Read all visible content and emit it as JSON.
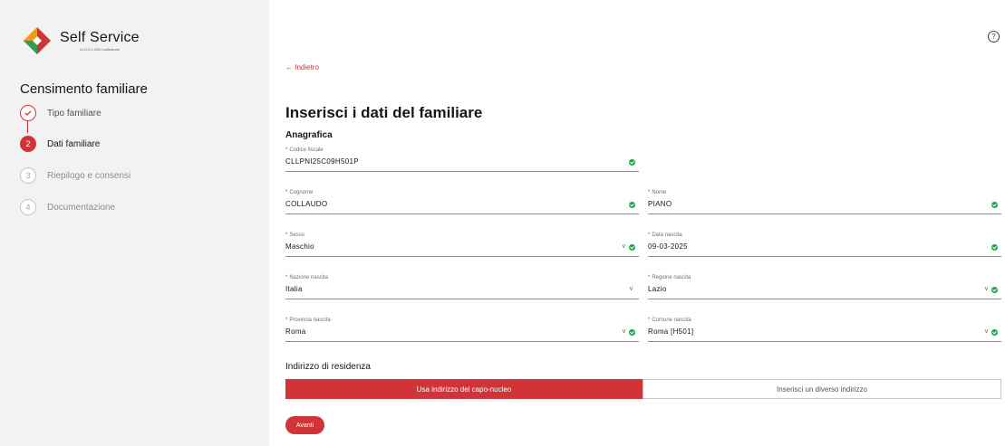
{
  "brand": {
    "title": "Self Service",
    "version": "v1.0.2-1.233.0-milestone",
    "colors": {
      "accent": "#d13438",
      "success": "#24a148"
    }
  },
  "sidebar": {
    "title": "Censimento familiare",
    "steps": [
      {
        "number": "",
        "icon": "check-icon",
        "label": "Tipo familiare",
        "state": "done"
      },
      {
        "number": "2",
        "label": "Dati familiare",
        "state": "active"
      },
      {
        "number": "3",
        "label": "Riepilogo e consensi",
        "state": "todo"
      },
      {
        "number": "4",
        "label": "Documentazione",
        "state": "todo"
      }
    ]
  },
  "header": {
    "help_icon": "?",
    "back_label": "← Indietro"
  },
  "main": {
    "title": "Inserisci i dati del familiare",
    "section": "Anagrafica",
    "fields": {
      "codice_fiscale": {
        "label": "Codice fiscale",
        "value": "CLLPNI25C09H501P"
      },
      "cognome": {
        "label": "Cognome",
        "value": "COLLAUDO"
      },
      "nome": {
        "label": "Nome",
        "value": "PIANO"
      },
      "sesso": {
        "label": "Sesso",
        "value": "Maschio"
      },
      "data_nascita": {
        "label": "Data nascita",
        "value": "09-03-2025"
      },
      "nazione_nascita": {
        "label": "Nazione nascita",
        "value": "Italia"
      },
      "regione_nascita": {
        "label": "Regione nascita",
        "value": "Lazio"
      },
      "provincia_nascita": {
        "label": "Provincia nascita",
        "value": "Roma"
      },
      "comune_nascita": {
        "label": "Comune nascita",
        "value": "Roma [H501]"
      }
    },
    "required_mark": "*",
    "chevron": "∨",
    "address": {
      "title": "Indirizzo di residenza",
      "option_same": "Usa indirizzo del capo-nucleo",
      "option_other": "Inserisci un diverso indirizzo"
    },
    "next_label": "Avanti"
  }
}
